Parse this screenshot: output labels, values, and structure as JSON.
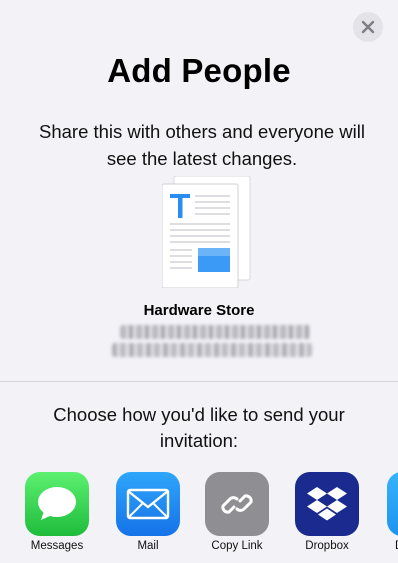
{
  "header": {
    "title": "Add People",
    "subtitle": "Share this with others and everyone will see the latest changes."
  },
  "document": {
    "name": "Hardware Store",
    "icon": "text-document-icon"
  },
  "share": {
    "prompt": "Choose how you'd like to send your invitation:",
    "apps": [
      {
        "label": "Messages",
        "icon": "messages-icon",
        "color": "#33c759"
      },
      {
        "label": "Mail",
        "icon": "mail-icon",
        "color": "#1e8ff7"
      },
      {
        "label": "Copy Link",
        "icon": "link-icon",
        "color": "#8e8e93"
      },
      {
        "label": "Dropbox",
        "icon": "dropbox-icon",
        "color": "#1b2a8f"
      },
      {
        "label": "D",
        "icon": "app-icon",
        "color": "#2aa3f5"
      }
    ]
  },
  "colors": {
    "background": "#f2f2f7",
    "accent": "#1e8ff7"
  }
}
